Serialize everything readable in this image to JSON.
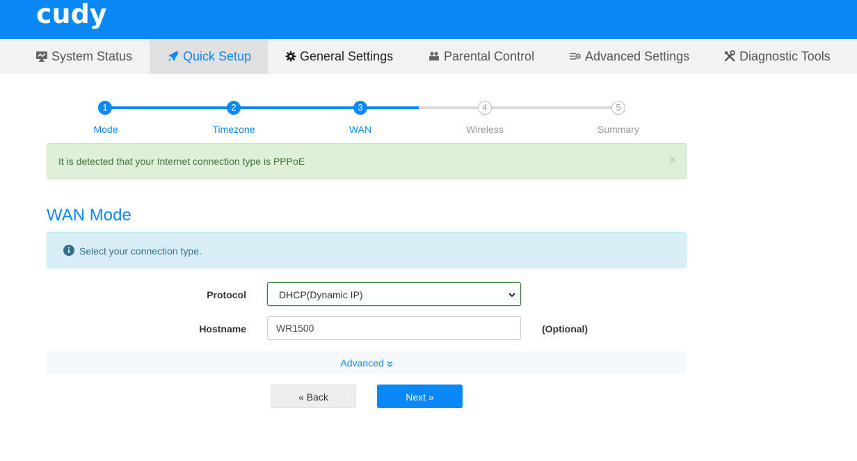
{
  "brand": {
    "logo": "cudy"
  },
  "nav": {
    "items": [
      {
        "label": "System Status",
        "icon": "monitor-icon"
      },
      {
        "label": "Quick Setup",
        "icon": "rocket-icon",
        "active": true
      },
      {
        "label": "General Settings",
        "icon": "gear-icon"
      },
      {
        "label": "Parental Control",
        "icon": "users-icon"
      },
      {
        "label": "Advanced Settings",
        "icon": "sliders-icon"
      },
      {
        "label": "Diagnostic Tools",
        "icon": "tools-icon"
      }
    ]
  },
  "stepper": {
    "steps": [
      {
        "num": "1",
        "label": "Mode",
        "done": true
      },
      {
        "num": "2",
        "label": "Timezone",
        "done": true
      },
      {
        "num": "3",
        "label": "WAN",
        "done": true
      },
      {
        "num": "4",
        "label": "Wireless",
        "done": false
      },
      {
        "num": "5",
        "label": "Summary",
        "done": false
      }
    ]
  },
  "detection_alert": {
    "message": "It is detected that your Internet connection type is PPPoE",
    "close": "×"
  },
  "section": {
    "title": "WAN Mode"
  },
  "info_alert": {
    "message": "Select your connection type.",
    "icon": "info-icon"
  },
  "form": {
    "protocol_label": "Protocol",
    "protocol_value": "DHCP(Dynamic IP)",
    "hostname_label": "Hostname",
    "hostname_value": "WR1500",
    "hostname_hint": "(Optional)",
    "advanced_label": "Advanced"
  },
  "buttons": {
    "back": "« Back",
    "next": "Next »"
  },
  "colors": {
    "accent": "#0a88f8",
    "success_bg": "#dff0d8",
    "info_bg": "#d9edf7"
  }
}
